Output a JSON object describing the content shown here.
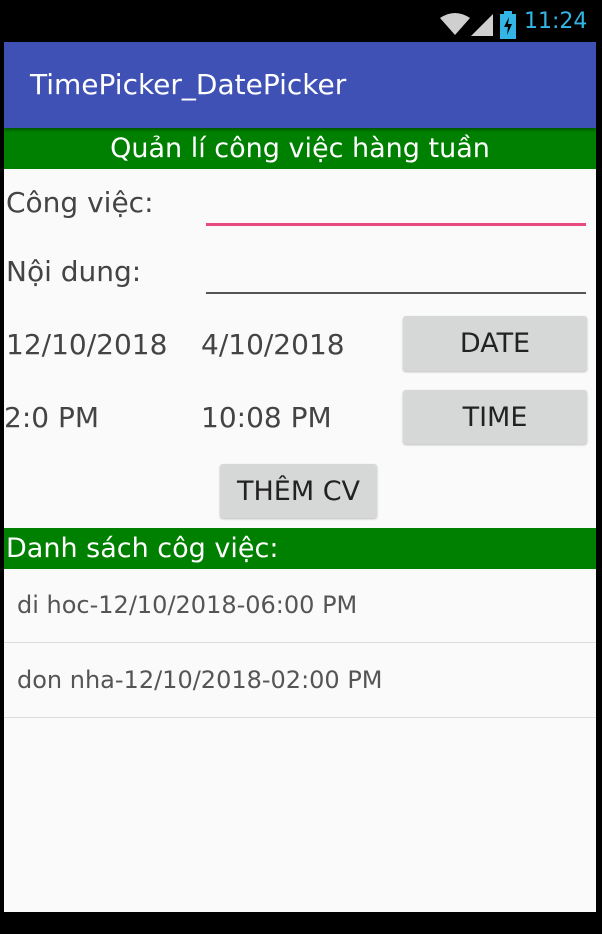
{
  "status_bar": {
    "time": "11:24",
    "icons": [
      "wifi-icon",
      "signal-icon",
      "battery-icon"
    ],
    "accent_color": "#33b5e5"
  },
  "app_bar": {
    "title": "TimePicker_DatePicker",
    "color": "#3f51b5"
  },
  "form": {
    "banner": "Quản lí công việc hàng tuần",
    "task_label": "Công việc:",
    "task_value": "",
    "content_label": "Nội dung:",
    "content_value": "",
    "selected_date": "12/10/2018",
    "current_date": "4/10/2018",
    "date_button": "DATE",
    "selected_time": "2:0 PM",
    "current_time": "10:08 PM",
    "time_button": "TIME",
    "add_button": "THÊM CV",
    "banner_color": "#008000"
  },
  "task_list": {
    "header": "Danh sách côg việc:",
    "items": [
      "di hoc-12/10/2018-06:00 PM",
      "don nha-12/10/2018-02:00 PM"
    ]
  }
}
